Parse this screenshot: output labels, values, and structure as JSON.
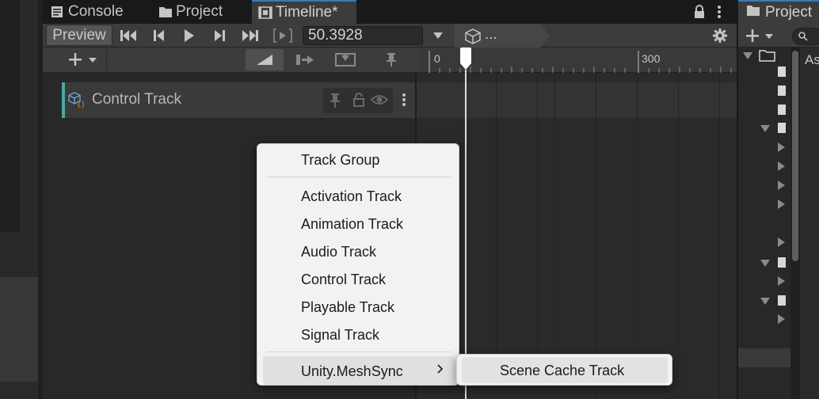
{
  "tabs": {
    "console": "Console",
    "project": "Project",
    "timeline": "Timeline*"
  },
  "toolbar": {
    "preview": "Preview",
    "time_value": "50.3928",
    "asset_crumb": "..."
  },
  "ruler": {
    "ticks": [
      "0",
      "300"
    ]
  },
  "track": {
    "label": "Control Track",
    "accent_color": "#48a9a0"
  },
  "context_menu": {
    "items": [
      "Track Group",
      "Activation Track",
      "Animation Track",
      "Audio Track",
      "Control Track",
      "Playable Track",
      "Signal Track",
      "Unity.MeshSync"
    ],
    "submenu": {
      "items": [
        "Scene Cache Track"
      ]
    }
  },
  "project_panel": {
    "tab_label": "Project",
    "column_label": "As"
  },
  "colors": {
    "active_tab_border": "#3a79bb",
    "menu_background": "#f2f2f2"
  }
}
